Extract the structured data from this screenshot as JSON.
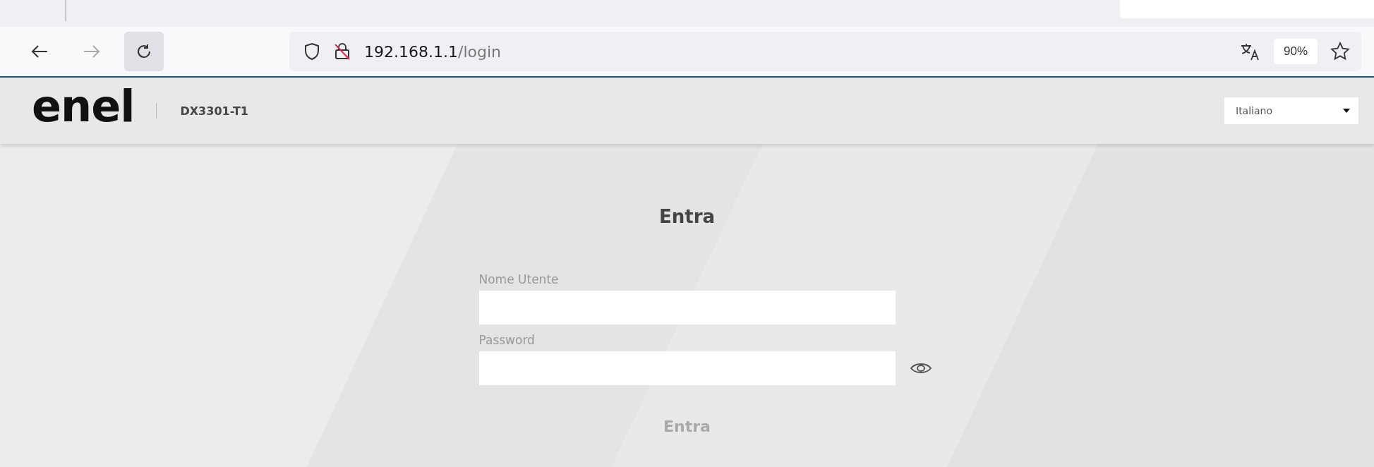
{
  "browser": {
    "url_host": "192.168.1.1",
    "url_path": "/login",
    "zoom": "90%",
    "back_disabled": false,
    "forward_disabled": true
  },
  "header": {
    "logo": "enel",
    "model": "DX3301-T1",
    "language": "Italiano"
  },
  "login": {
    "title": "Entra",
    "fields": [
      {
        "label": "Nome Utente",
        "kind": "text"
      },
      {
        "label": "Password",
        "kind": "password"
      }
    ],
    "submit": {
      "label": "Entra",
      "disabled": true
    }
  }
}
